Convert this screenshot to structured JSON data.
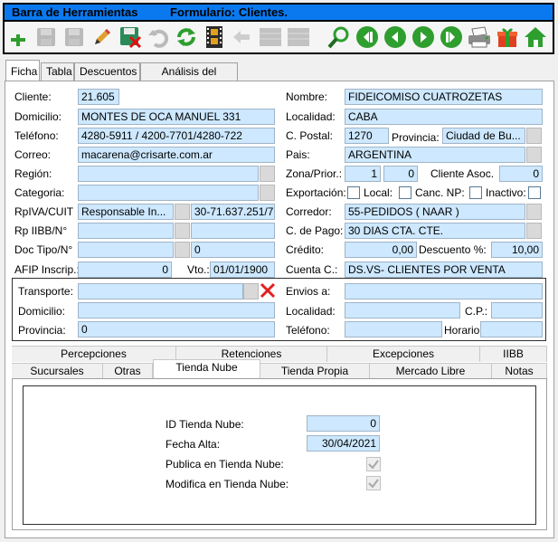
{
  "title": {
    "app": "Barra de Herramientas",
    "form": "Formulario: Clientes."
  },
  "toolbar": {
    "icons": [
      "add-icon",
      "save-icon",
      "save-disabled-icon",
      "edit-icon",
      "delete-save-icon",
      "undo-icon",
      "refresh-icon",
      "film-icon",
      "back-icon",
      "grid-icon",
      "grid-icon",
      "search-icon",
      "first-icon",
      "prev-icon",
      "next-icon",
      "last-icon",
      "print-icon",
      "gift-icon",
      "home-icon"
    ]
  },
  "tabs": [
    "Ficha",
    "Tabla",
    "Descuentos",
    "Análisis del Cliente"
  ],
  "labels": {
    "cliente": "Cliente:",
    "domicilio": "Domicilio:",
    "telefono": "Teléfono:",
    "correo": "Correo:",
    "region": "Región:",
    "categoria": "Categoria:",
    "rpiva": "RpIVA/CUIT",
    "rpiibb": "Rp IIBB/N°",
    "doctipo": "Doc Tipo/N°",
    "afip": "AFIP Inscrip.:",
    "vto": "Vto.:",
    "nombre": "Nombre:",
    "localidad": "Localidad:",
    "cpostal": "C. Postal:",
    "provincia": "Provincia:",
    "pais": "Pais:",
    "zona": "Zona/Prior.:",
    "cliente_asoc": "Cliente Asoc.",
    "exportacion": "Exportación:",
    "local": "Local:",
    "canc_np": "Canc. NP:",
    "inactivo": "Inactivo:",
    "corredor": "Corredor:",
    "cdepago": "C. de Pago:",
    "credito": "Crédito:",
    "descuento": "Descuento %:",
    "cuenta_c": "Cuenta C.:",
    "transporte": "Transporte:",
    "envios_a": "Envios a:",
    "t_domicilio": "Domicilio:",
    "t_localidad": "Localidad:",
    "t_cp": "C.P.:",
    "t_provincia": "Provincia:",
    "t_telefono": "Teléfono:",
    "t_horario": "Horario"
  },
  "values": {
    "cliente": "21.605",
    "domicilio": "MONTES DE OCA MANUEL 331",
    "telefono": "4280-5911 / 4200-7701/4280-722",
    "correo": "macarena@crisarte.com.ar",
    "region": "",
    "categoria": "",
    "rpiva": "Responsable In...",
    "cuit": "30-71.637.251/7",
    "rpiibb": "",
    "rpiibb_num": "",
    "doctipo": "",
    "docnum": "0",
    "afip": "0",
    "vto": "01/01/1900",
    "nombre": "FIDEICOMISO CUATROZETAS",
    "localidad": "CABA",
    "cpostal": "1270",
    "provincia": "Ciudad de Bu...",
    "pais": "ARGENTINA",
    "zona": "1",
    "prior": "0",
    "cliente_asoc": "0",
    "corredor": "55-PEDIDOS ( NAAR )",
    "cdepago": "30 DIAS CTA. CTE.",
    "credito": "0,00",
    "descuento": "10,00",
    "cuenta_c": "DS.VS- CLIENTES POR VENTA",
    "transporte": "",
    "envios_a": "",
    "t_domicilio": "",
    "t_localidad": "",
    "t_cp": "",
    "t_provincia": "0",
    "t_telefono": "",
    "t_horario": ""
  },
  "inner_tabs_row1": [
    "Percepciones",
    "Retenciones",
    "Excepciones",
    "IIBB"
  ],
  "inner_tabs_row2": [
    "Sucursales",
    "Otras",
    "Tienda Nube",
    "Tienda Propia",
    "Mercado Libre",
    "Notas"
  ],
  "tienda_nube": {
    "id_label": "ID Tienda Nube:",
    "id_value": "0",
    "fecha_label": "Fecha Alta:",
    "fecha_value": "30/04/2021",
    "publica_label": "Publica en Tienda Nube:",
    "publica_checked": true,
    "modifica_label": "Modifica en Tienda Nube:",
    "modifica_checked": true
  }
}
